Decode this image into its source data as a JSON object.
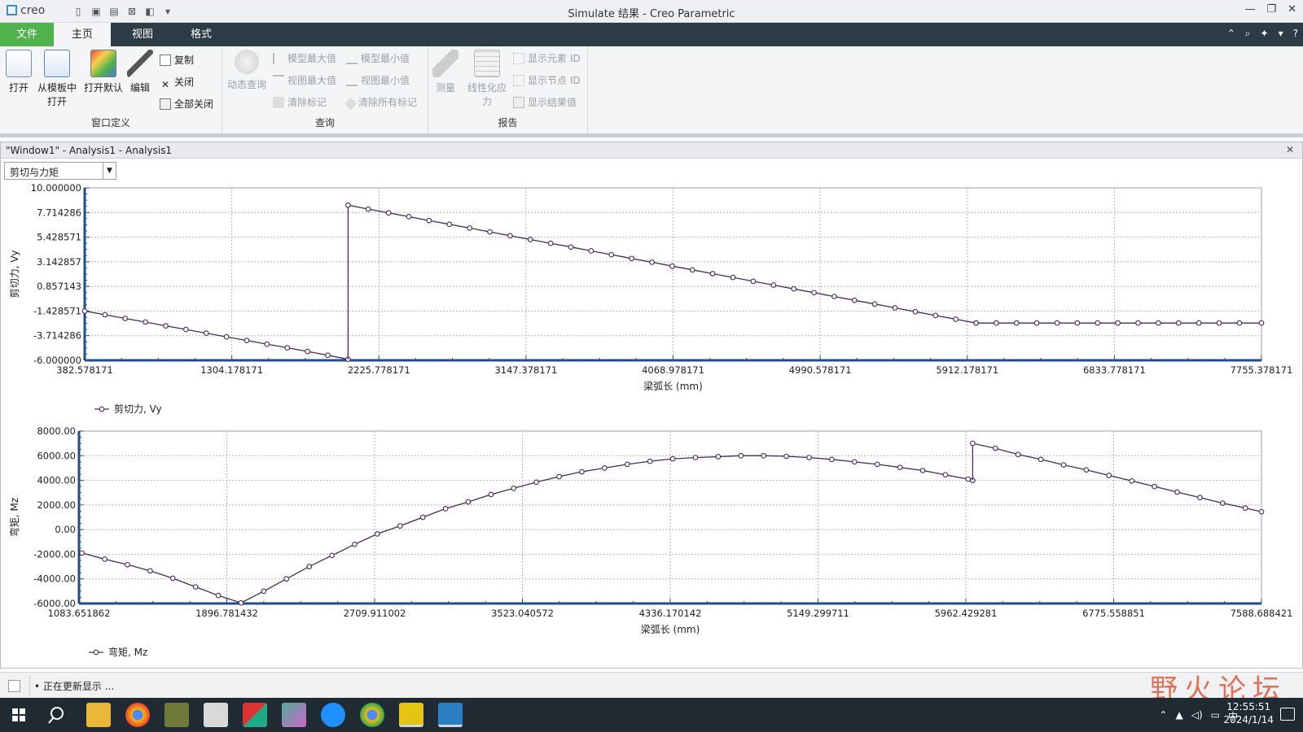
{
  "window": {
    "app_logo": "creo",
    "title": "Simulate 结果 - Creo Parametric",
    "controls": [
      "—",
      "❐",
      "✕"
    ]
  },
  "tabs": {
    "file": "文件",
    "home": "主页",
    "view": "视图",
    "format": "格式"
  },
  "ribbon": {
    "window_def": {
      "title": "窗口定义",
      "open": "打开",
      "open_template_1": "从模板中",
      "open_template_2": "打开",
      "open_default": "打开默认",
      "edit": "编辑",
      "copy": "复制",
      "close": "关闭",
      "close_all": "全部关闭"
    },
    "query": {
      "title": "查询",
      "dynamic_query": "动态查询",
      "model_max": "模型最大值",
      "model_min": "模型最小值",
      "view_max": "视图最大值",
      "view_min": "视图最小值",
      "clear_mark": "清除标记",
      "clear_all_marks": "清除所有标记"
    },
    "report": {
      "title": "报告",
      "measure": "测量",
      "linearize_1": "线性化应",
      "linearize_2": "力",
      "show_element_id": "显示元素 ID",
      "show_node_id": "显示节点 ID",
      "show_result_value": "显示结果值"
    }
  },
  "doc": {
    "title": "\"Window1\" - Analysis1 - Analysis1",
    "combo_value": "剪切与力矩"
  },
  "chart_data": [
    {
      "type": "line",
      "ylabel": "剪切力, Vy",
      "xlabel": "梁弧长 (mm)",
      "legend": "剪切力, Vy",
      "legend_position": "bottom-left",
      "grid": true,
      "xlim": [
        382.578171,
        7755.378171
      ],
      "ylim": [
        -6.0,
        10.0
      ],
      "x_ticks": [
        "382.578171",
        "1304.178171",
        "2225.778171",
        "3147.378171",
        "4068.978171",
        "4990.578171",
        "5912.178171",
        "6833.778171",
        "7755.378171"
      ],
      "y_ticks": [
        "10.000000",
        "7.714286",
        "5.428571",
        "3.142857",
        "0.857143",
        "-1.428571",
        "-3.714286",
        "-6.000000"
      ],
      "series_color": "#4a2a5a",
      "segments": [
        {
          "x": [
            382.6,
            509.5,
            636.4,
            763.4,
            890.3,
            1017.2,
            1144.1,
            1271.0,
            1398.0,
            1524.9,
            1651.8,
            1778.7,
            1905.6,
            2032.6
          ],
          "y": [
            -1.43,
            -1.77,
            -2.11,
            -2.45,
            -2.8,
            -3.14,
            -3.48,
            -3.82,
            -4.16,
            -4.5,
            -4.84,
            -5.18,
            -5.53,
            -5.9
          ]
        },
        {
          "x": [
            2032.6,
            2032.6
          ],
          "y": [
            -5.9,
            8.4
          ]
        },
        {
          "x": [
            2032.6,
            2159.5,
            2286.4,
            2413.3,
            2540.3,
            2667.2,
            2794.1,
            2921.0,
            3047.9,
            3174.9,
            3301.8,
            3428.7,
            3555.6,
            3682.5,
            3809.5,
            3936.4,
            4063.3,
            4190.2,
            4317.1,
            4444.1,
            4571.0,
            4698.0,
            4824.9,
            4951.8,
            5078.7,
            5205.6,
            5332.6,
            5459.5,
            5586.4,
            5713.3,
            5840.2,
            5967.2
          ],
          "y": [
            8.4,
            8.03,
            7.68,
            7.33,
            6.97,
            6.62,
            6.27,
            5.92,
            5.56,
            5.21,
            4.86,
            4.51,
            4.15,
            3.8,
            3.45,
            3.1,
            2.74,
            2.39,
            2.04,
            1.69,
            1.33,
            0.98,
            0.63,
            0.28,
            -0.08,
            -0.43,
            -0.78,
            -1.13,
            -1.49,
            -1.84,
            -2.19,
            -2.54
          ]
        },
        {
          "x": [
            5967.2,
            6094.1,
            6221.0,
            6347.9,
            6474.8,
            6601.8,
            6728.7,
            6855.6,
            6982.5,
            7109.4,
            7236.4,
            7363.3,
            7490.2,
            7617.1,
            7755.4
          ],
          "y": [
            -2.54,
            -2.54,
            -2.54,
            -2.54,
            -2.54,
            -2.54,
            -2.54,
            -2.54,
            -2.54,
            -2.54,
            -2.54,
            -2.54,
            -2.54,
            -2.54,
            -2.54
          ]
        }
      ]
    },
    {
      "type": "line",
      "ylabel": "弯矩, Mz",
      "xlabel": "梁弧长 (mm)",
      "legend": "弯矩, Mz",
      "legend_position": "bottom-left",
      "grid": true,
      "xlim": [
        1083.651862,
        7588.688421
      ],
      "ylim": [
        -6000.0,
        8000.0
      ],
      "x_ticks": [
        "1083.651862",
        "1896.781432",
        "2709.911002",
        "3523.040572",
        "4336.170142",
        "5149.299711",
        "5962.429281",
        "6775.558851",
        "7588.688421"
      ],
      "y_ticks": [
        "8000.00",
        "6000.00",
        "4000.00",
        "2000.00",
        "0.00",
        "-2000.00",
        "-4000.00",
        "-6000.00"
      ],
      "series_color": "#4a2a5a",
      "segments": [
        {
          "x": [
            1100,
            1225,
            1350,
            1475,
            1600,
            1725,
            1850,
            1975,
            2100,
            2225,
            2350,
            2475,
            2600,
            2725,
            2850,
            2975,
            3100,
            3225,
            3350,
            3475,
            3600,
            3725,
            3850,
            3975,
            4100,
            4225,
            4350,
            4475,
            4600,
            4725,
            4850,
            4975,
            5100,
            5225,
            5350,
            5475,
            5600,
            5725,
            5850,
            5975,
            6000
          ],
          "y": [
            -1900,
            -2400,
            -2850,
            -3350,
            -3950,
            -4650,
            -5350,
            -5950,
            -5000,
            -4000,
            -3000,
            -2100,
            -1200,
            -350,
            300,
            1000,
            1700,
            2250,
            2850,
            3350,
            3850,
            4300,
            4700,
            5000,
            5300,
            5550,
            5750,
            5850,
            5920,
            6000,
            6000,
            5950,
            5850,
            5700,
            5500,
            5300,
            5050,
            4800,
            4450,
            4100,
            4000
          ]
        },
        {
          "x": [
            6000,
            6000
          ],
          "y": [
            4000,
            7000
          ]
        },
        {
          "x": [
            6000,
            6125,
            6250,
            6375,
            6500,
            6625,
            6750,
            6875,
            7000,
            7125,
            7250,
            7375,
            7500,
            7588.7
          ],
          "y": [
            7000,
            6600,
            6100,
            5700,
            5250,
            4850,
            4400,
            3950,
            3500,
            3050,
            2600,
            2150,
            1750,
            1450
          ]
        }
      ]
    }
  ],
  "status": {
    "message": "• 正在更新显示 ..."
  },
  "watermark": "野火论坛",
  "taskbar": {
    "clock_time": "12:55:51",
    "clock_date": "2024/1/14",
    "ime": "中"
  }
}
